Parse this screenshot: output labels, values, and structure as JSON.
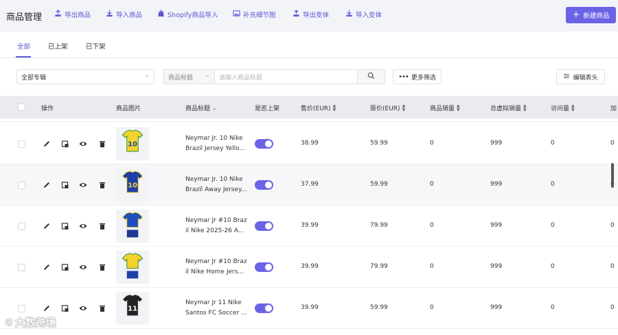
{
  "header": {
    "title": "商品管理",
    "toolbar": [
      {
        "label": "导出商品",
        "icon": "upload-icon"
      },
      {
        "label": "导入商品",
        "icon": "download-icon"
      },
      {
        "label": "Shopify商品导入",
        "icon": "shopify-icon"
      },
      {
        "label": "补充细节图",
        "icon": "image-icon"
      },
      {
        "label": "导出变体",
        "icon": "upload-icon"
      },
      {
        "label": "导入变体",
        "icon": "download-icon"
      }
    ],
    "new_button": "新建商品",
    "accent": "#6b63e6"
  },
  "tabs": [
    "全部",
    "已上架",
    "已下架"
  ],
  "filters": {
    "collection": "全部专辑",
    "search_field": "商品标题",
    "search_placeholder": "请输入商品标题",
    "more_filters": "更多筛选",
    "edit_header": "编辑表头"
  },
  "columns": {
    "action": "操作",
    "image": "商品图片",
    "title": "商品标题",
    "listed": "是否上架",
    "price": "售价(EUR)",
    "orig_price": "原价(EUR)",
    "sales": "商品销量",
    "virtual_sales": "总虚拟销量",
    "visits": "访问量",
    "extra": "加"
  },
  "rows": [
    {
      "title1": "Neymar Jr. 10 Nike",
      "title2": "Brazil Jersey Yello...",
      "listed": true,
      "price": "38.99",
      "orig_price": "59.99",
      "sales": "0",
      "virtual_sales": "999",
      "visits": "0",
      "extra": "0",
      "jersey": "yellow",
      "number": "10"
    },
    {
      "title1": "Neymar Jr. 10 Nike",
      "title2": "Brazil Away Jersey...",
      "listed": true,
      "price": "37.99",
      "orig_price": "59.99",
      "sales": "0",
      "virtual_sales": "999",
      "visits": "0",
      "extra": "0",
      "jersey": "blue",
      "number": "10"
    },
    {
      "title1": "Neymar Jr #10 Braz",
      "title2": "il Nike 2025-26 A...",
      "listed": true,
      "price": "39.99",
      "orig_price": "79.99",
      "sales": "0",
      "virtual_sales": "999",
      "visits": "0",
      "extra": "0",
      "jersey": "blue-kit",
      "number": ""
    },
    {
      "title1": "Neymar Jr #10 Braz",
      "title2": "il Nike Home Jers...",
      "listed": true,
      "price": "39.99",
      "orig_price": "79.99",
      "sales": "0",
      "virtual_sales": "999",
      "visits": "0",
      "extra": "0",
      "jersey": "yellow-kit",
      "number": ""
    },
    {
      "title1": "Neymar Jr 11 Nike",
      "title2": "Santos FC Soccer ...",
      "listed": true,
      "price": "39.99",
      "orig_price": "59.99",
      "sales": "0",
      "virtual_sales": "999",
      "visits": "0",
      "extra": "0",
      "jersey": "black",
      "number": "11"
    }
  ],
  "watermark": "大数跨境"
}
